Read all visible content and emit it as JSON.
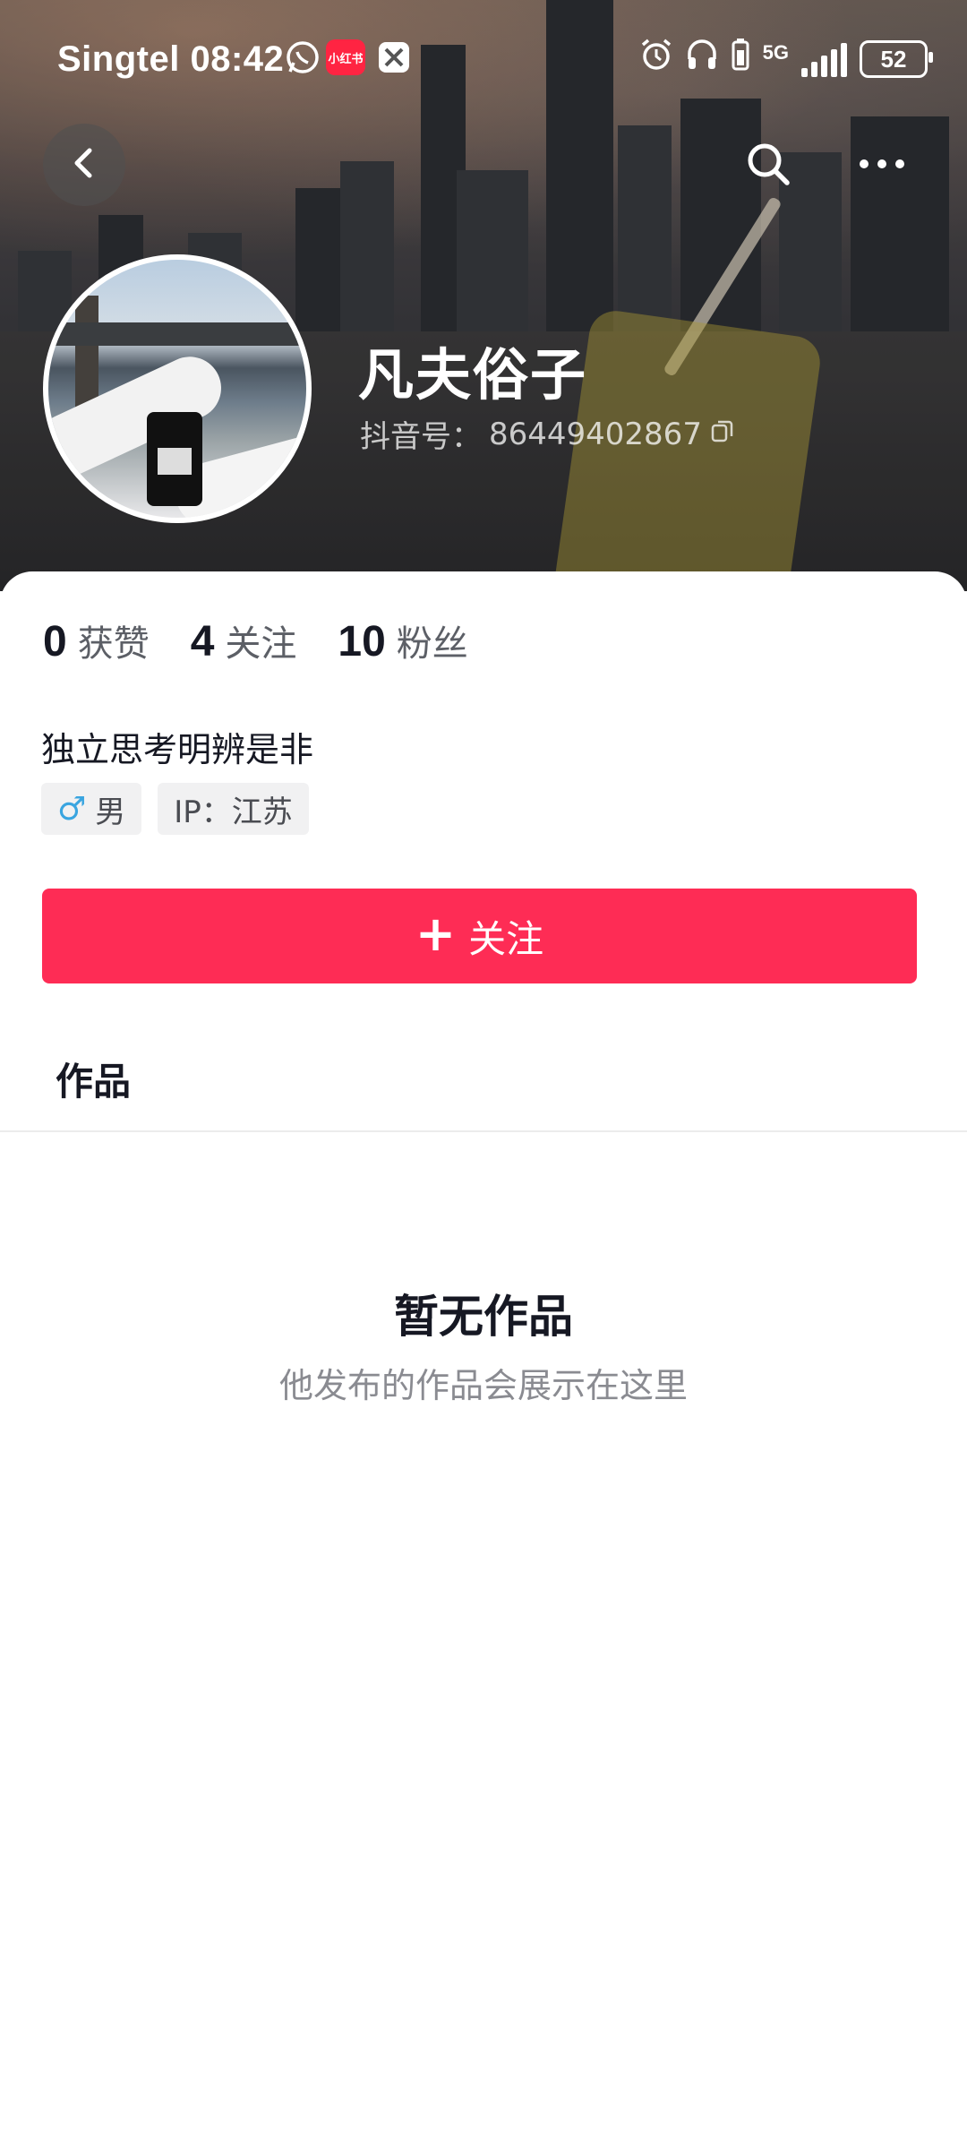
{
  "status_bar": {
    "carrier": "Singtel",
    "time": "08:42",
    "app_badge": "小红书",
    "network": "5G",
    "battery": "52"
  },
  "header": {
    "back_icon": "chevron-left-icon",
    "search_icon": "search-icon",
    "more_icon": "more-horizontal-icon"
  },
  "profile": {
    "nickname": "凡夫俗子",
    "douyin_id_label": "抖音号：",
    "douyin_id": "86449402867",
    "copy_icon": "copy-icon",
    "stats": [
      {
        "num": "0",
        "label": "获赞"
      },
      {
        "num": "4",
        "label": "关注"
      },
      {
        "num": "10",
        "label": "粉丝"
      }
    ],
    "bio": "独立思考明辨是非",
    "tags": [
      {
        "icon": "♂",
        "text": "男"
      },
      {
        "text": "IP：江苏"
      }
    ]
  },
  "actions": {
    "follow_plus": "+",
    "follow_label": "关注"
  },
  "tabs": {
    "works": "作品"
  },
  "empty_state": {
    "title": "暂无作品",
    "subtitle": "他发布的作品会展示在这里"
  },
  "colors": {
    "accent": "#fe2c55",
    "male": "#3aa5e0"
  }
}
